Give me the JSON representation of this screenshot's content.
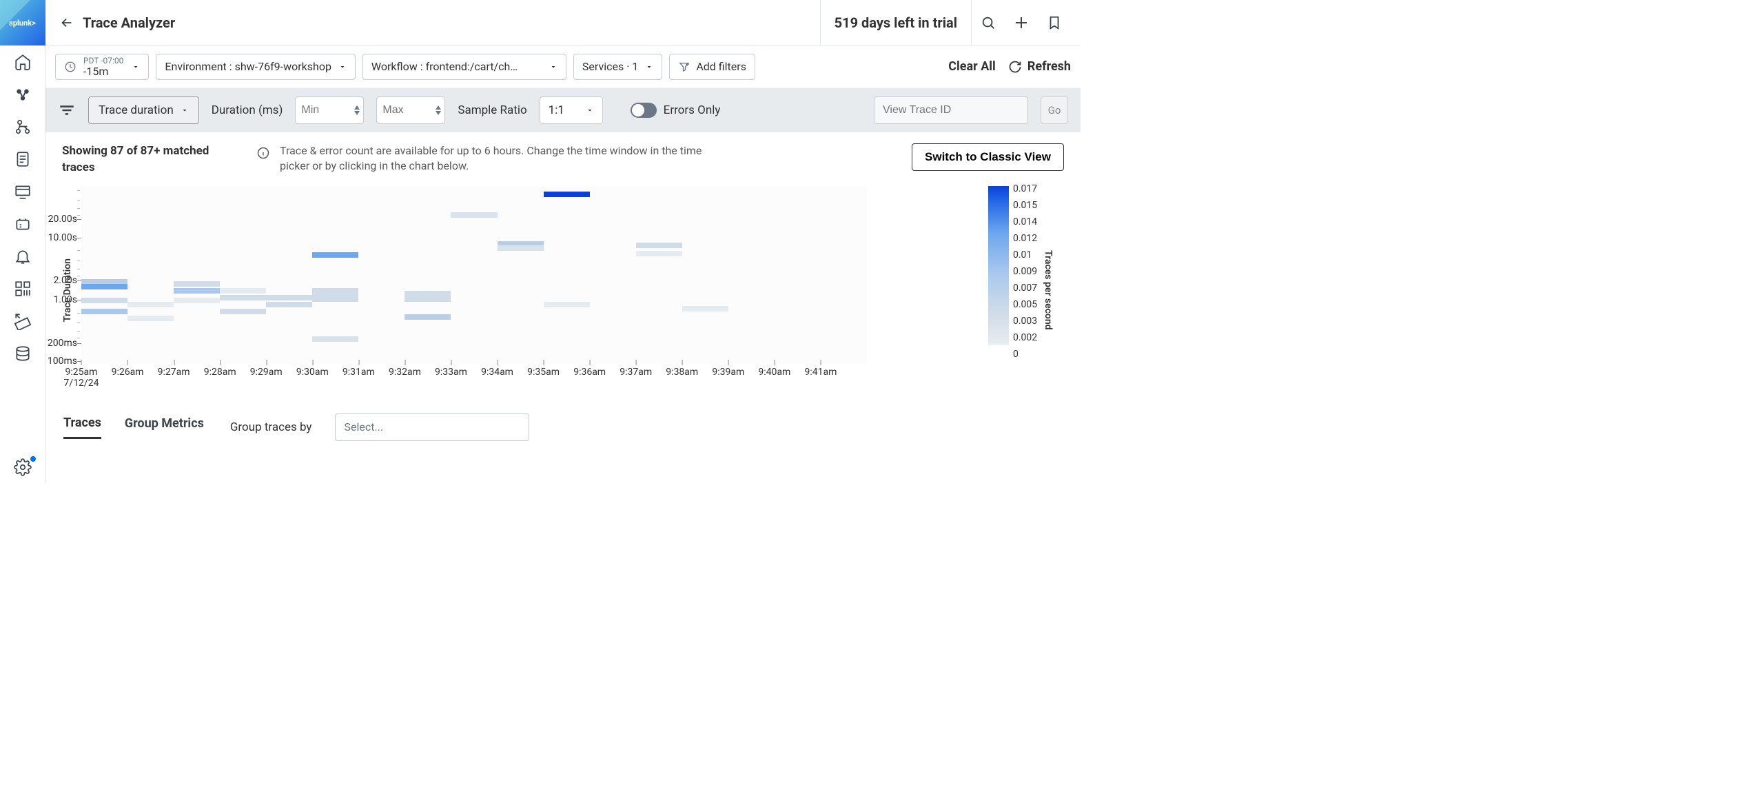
{
  "header": {
    "title": "Trace Analyzer",
    "trial_text": "519 days left in trial"
  },
  "sidebar": {
    "logo_text": "splunk>"
  },
  "filters": {
    "timezone": "PDT -07:00",
    "time_value": "-15m",
    "environment_label": "Environment : shw-76f9-workshop",
    "workflow_label": "Workflow : frontend:/cart/ch…",
    "services_label": "Services · 1",
    "add_filters_label": "Add filters",
    "clear_all_label": "Clear All",
    "refresh_label": "Refresh"
  },
  "toolbar": {
    "metric_label": "Trace duration",
    "duration_label": "Duration (ms)",
    "min_placeholder": "Min",
    "max_placeholder": "Max",
    "sample_ratio_label": "Sample Ratio",
    "sample_ratio_value": "1:1",
    "errors_only_label": "Errors Only",
    "trace_id_placeholder": "View Trace ID",
    "go_label": "Go"
  },
  "info": {
    "showing_text": "Showing 87 of 87+ matched traces",
    "message": "Trace & error count are available for up to 6 hours. Change the time window in the time picker or by clicking in the chart below.",
    "classic_button": "Switch to Classic View"
  },
  "tabs": {
    "traces_label": "Traces",
    "group_metrics_label": "Group Metrics",
    "group_by_label": "Group traces by",
    "group_select_placeholder": "Select..."
  },
  "chart_data": {
    "type": "heatmap",
    "ylabel": "Trace Duration",
    "color_label": "Traces per second",
    "y_ticks": [
      {
        "label": "20.00s",
        "pos": 48
      },
      {
        "label": "10.00s",
        "pos": 75
      },
      {
        "label": "2.00s",
        "pos": 137
      },
      {
        "label": "1.00s",
        "pos": 165
      },
      {
        "label": "200ms",
        "pos": 228
      },
      {
        "label": "100ms",
        "pos": 254
      }
    ],
    "y_minor_ticks": [
      6,
      20,
      32,
      42,
      93,
      108,
      120,
      130,
      184,
      198,
      210,
      220
    ],
    "x_ticks": [
      "9:25am",
      "9:26am",
      "9:27am",
      "9:28am",
      "9:29am",
      "9:30am",
      "9:31am",
      "9:32am",
      "9:33am",
      "9:34am",
      "9:35am",
      "9:36am",
      "9:37am",
      "9:38am",
      "9:39am",
      "9:40am",
      "9:41am"
    ],
    "x_date": "7/12/24",
    "color_scale": [
      "0.017",
      "0.015",
      "0.014",
      "0.012",
      "0.01",
      "0.009",
      "0.007",
      "0.005",
      "0.003",
      "0.002",
      "0"
    ],
    "cells": [
      {
        "x": 0,
        "y": 135,
        "c": "#b7cee5"
      },
      {
        "x": 0,
        "y": 142,
        "c": "#6ea7ee"
      },
      {
        "x": 0,
        "y": 162,
        "c": "#d0dce8"
      },
      {
        "x": 0,
        "y": 178,
        "c": "#a9c8ee"
      },
      {
        "x": 1,
        "y": 168,
        "c": "#e6ebef"
      },
      {
        "x": 1,
        "y": 188,
        "c": "#e6ebef"
      },
      {
        "x": 2,
        "y": 138,
        "c": "#d0dce8"
      },
      {
        "x": 2,
        "y": 148,
        "c": "#a9c8ee"
      },
      {
        "x": 2,
        "y": 162,
        "c": "#e6ebef"
      },
      {
        "x": 3,
        "y": 148,
        "c": "#e6ebef"
      },
      {
        "x": 3,
        "y": 158,
        "c": "#d0dce8"
      },
      {
        "x": 3,
        "y": 178,
        "c": "#d0dce8"
      },
      {
        "x": 4,
        "y": 158,
        "c": "#d0dce8"
      },
      {
        "x": 4,
        "y": 168,
        "c": "#d0dce8"
      },
      {
        "x": 5,
        "y": 96,
        "c": "#6ea7ee"
      },
      {
        "x": 5,
        "y": 148,
        "c": "#d0dce8"
      },
      {
        "x": 5,
        "y": 152,
        "c": "#d0dce8"
      },
      {
        "x": 5,
        "y": 160,
        "c": "#d0dce8"
      },
      {
        "x": 5,
        "y": 218,
        "c": "#d8e2ea"
      },
      {
        "x": 7,
        "y": 152,
        "c": "#d0dce8"
      },
      {
        "x": 7,
        "y": 160,
        "c": "#d0dce8"
      },
      {
        "x": 7,
        "y": 186,
        "c": "#b7cee5"
      },
      {
        "x": 8,
        "y": 38,
        "c": "#d8e2ea"
      },
      {
        "x": 9,
        "y": 80,
        "c": "#b7cee5"
      },
      {
        "x": 9,
        "y": 86,
        "c": "#d8e2ea"
      },
      {
        "x": 10,
        "y": 8,
        "c": "#0b3fd6"
      },
      {
        "x": 10,
        "y": 168,
        "c": "#e6ebef"
      },
      {
        "x": 12,
        "y": 82,
        "c": "#d0dce8"
      },
      {
        "x": 12,
        "y": 94,
        "c": "#e6ebef"
      },
      {
        "x": 13,
        "y": 174,
        "c": "#e6ebef"
      }
    ]
  }
}
